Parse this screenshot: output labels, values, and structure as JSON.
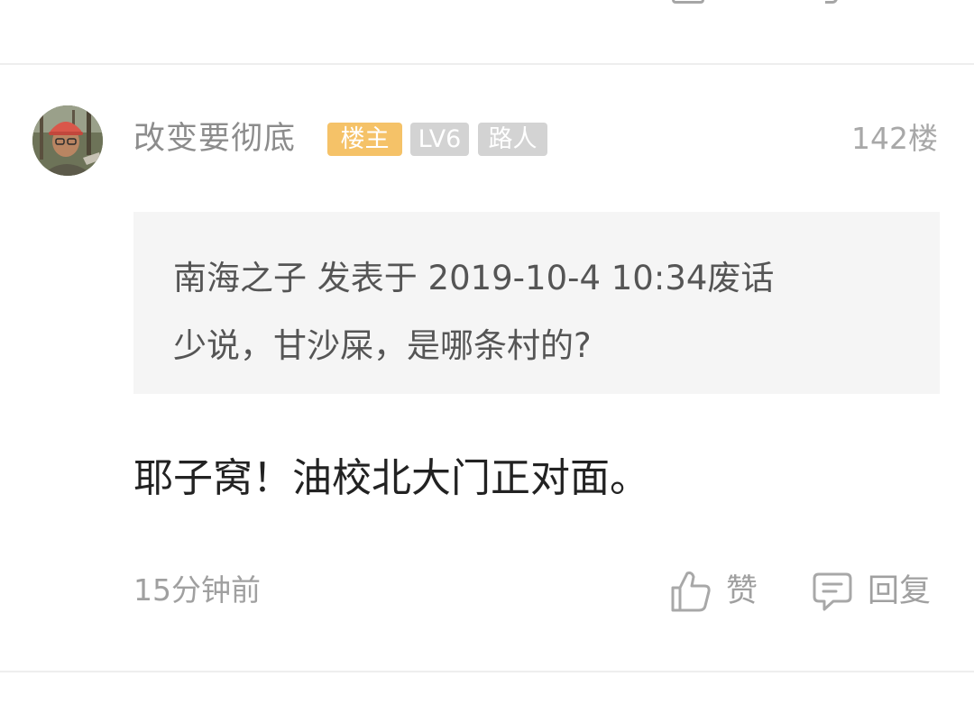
{
  "post": {
    "username": "改变要彻底",
    "badges": {
      "owner": "楼主",
      "level": "LV6",
      "role": "路人"
    },
    "floor": "142楼",
    "quote": {
      "line1": "南海之子 发表于 2019-10-4 10:34废话",
      "line2": "少说，甘沙屎，是哪条村的?"
    },
    "content": "耶子窝！油校北大门正对面。",
    "time": "15分钟前",
    "actions": {
      "like_label": "赞",
      "reply_label": "回复"
    }
  },
  "icons": {
    "like": "thumbs-up-icon",
    "reply": "comment-bubble-icon"
  },
  "colors": {
    "owner_badge": "#f5c268",
    "grey_badge": "#d3d3d3",
    "quote_background": "#f5f5f5",
    "secondary_text": "#a0a0a0"
  }
}
